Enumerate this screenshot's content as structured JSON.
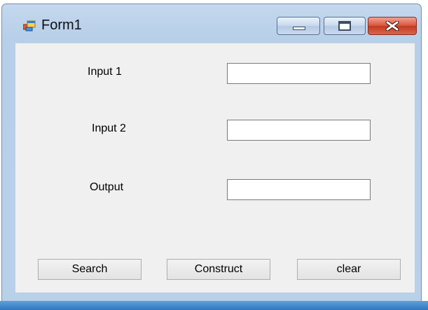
{
  "window": {
    "title": "Form1"
  },
  "form": {
    "input1_label": "Input 1",
    "input1_value": "",
    "input2_label": "Input 2",
    "input2_value": "",
    "output_label": "Output",
    "output_value": ""
  },
  "buttons": {
    "search": "Search",
    "construct": "Construct",
    "clear": "clear"
  },
  "icons": {
    "app": "form-window-icon",
    "minimize": "minimize-icon",
    "maximize": "maximize-icon",
    "close": "close-icon"
  },
  "colors": {
    "close_button": "#c43a22",
    "client_background": "#f0f0f0",
    "frame": "#b9d0e9"
  }
}
